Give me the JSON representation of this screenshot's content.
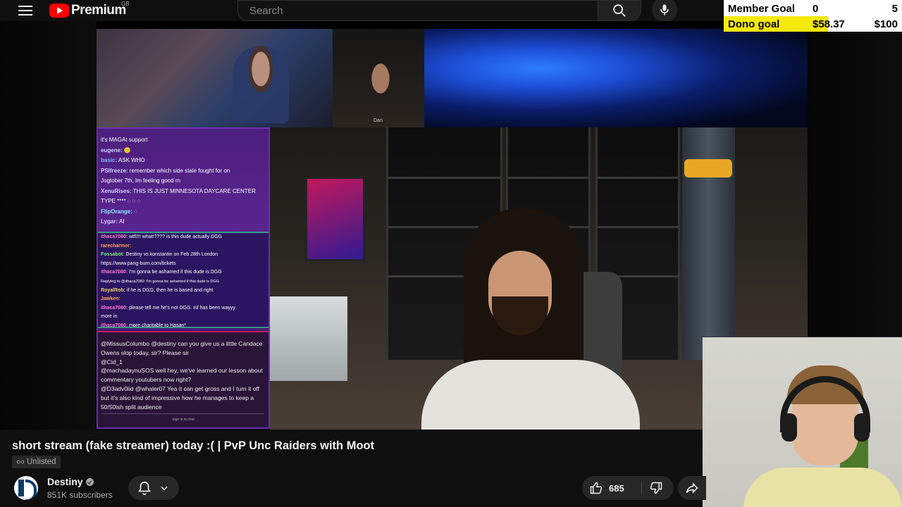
{
  "header": {
    "logo_text": "Premium",
    "country": "GB",
    "search_placeholder": "Search"
  },
  "goals": {
    "member": {
      "label": "Member Goal",
      "current": "0",
      "target": "5",
      "progress": 0.0
    },
    "dono": {
      "label": "Dono goal",
      "current": "$58.37",
      "target": "$100",
      "progress": 0.5837
    }
  },
  "video": {
    "cam_name": "Dan",
    "chat": {
      "section1": [
        {
          "name": "",
          "text": "it's MAGAt support",
          "color": "white"
        },
        {
          "name": "eugene:",
          "text": "🙂",
          "color": "light"
        },
        {
          "name": "basic:",
          "text": "ASK WHO",
          "color": "blue"
        },
        {
          "name": "PSIfreeze:",
          "text": "remember which side stale fought for on",
          "color": "light"
        },
        {
          "name": "",
          "text": "Jogtober 7th, Im feeling good rn",
          "color": "white"
        },
        {
          "name": "XenuRises:",
          "text": "THIS IS JUST MINNESOTA DAYCARE CENTER",
          "color": "light"
        },
        {
          "name": "",
          "text": "TYPE **** ◌ ◌ ◌",
          "color": "white"
        },
        {
          "name": "FlipOrange:",
          "text": "◌",
          "color": "cyan"
        },
        {
          "name": "Lygar:",
          "text": "AI",
          "color": "light"
        }
      ],
      "section2": [
        {
          "name": "ithaca7080:",
          "text": "wtf!!!! what!???? is this dude actually DGG",
          "color": "pink"
        },
        {
          "name": "rarecharmer:",
          "text": "",
          "color": "orange"
        },
        {
          "name": "Fossabot:",
          "text": "Destiny vs konstantin on Feb 28th London",
          "color": "green"
        },
        {
          "name": "",
          "text": "https://www.pang-burn.com/tickets",
          "color": "white"
        },
        {
          "name": "ithaca7080:",
          "text": "I'm gonna be ashamed if this dude is DGG",
          "color": "pink"
        },
        {
          "name": "",
          "text": "Replying to @ithaca7080: I'm gonna be ashamed if this dude is DGG",
          "color": "light"
        },
        {
          "name": "RoyalRob:",
          "text": "if he is DGG, then he is based and right",
          "color": "gold"
        },
        {
          "name": "Jawken:",
          "text": "",
          "color": "orange"
        },
        {
          "name": "ithaca7080:",
          "text": "please tell me he's not DGG. Isf has been wayyy",
          "color": "pink"
        },
        {
          "name": "",
          "text": "more in",
          "color": "white"
        },
        {
          "name": "ithaca7080:",
          "text": "more charitable to Hasan*",
          "color": "pink"
        }
      ],
      "section3": [
        {
          "name": "@MissusColumbo",
          "text": "@destiny can you give us a little Candace Owens slop today, sir? Please sir"
        },
        {
          "name": "@Cid_1",
          "text": ""
        },
        {
          "name": "@machadaynuSOS",
          "text": "well hey, we've learned our lesson about commentary youtubers now right?"
        },
        {
          "name": "@D3adv0iid",
          "text": "@whaler07 Yea it can get gross and I turn it off but it's also kind of impressive how he manages to keep a 50/50ish split audience"
        }
      ],
      "footer": "Sign in to chat"
    }
  },
  "info": {
    "title": "short stream (fake streamer) today :( | PvP Unc Raiders with Moot",
    "visibility": "Unlisted",
    "channel_name": "Destiny",
    "subscribers": "851K subscribers",
    "likes": "685"
  },
  "colors": {
    "accent_red": "#ff0000",
    "goal_yellow": "#f5e90a",
    "chip_bg": "#272727"
  }
}
